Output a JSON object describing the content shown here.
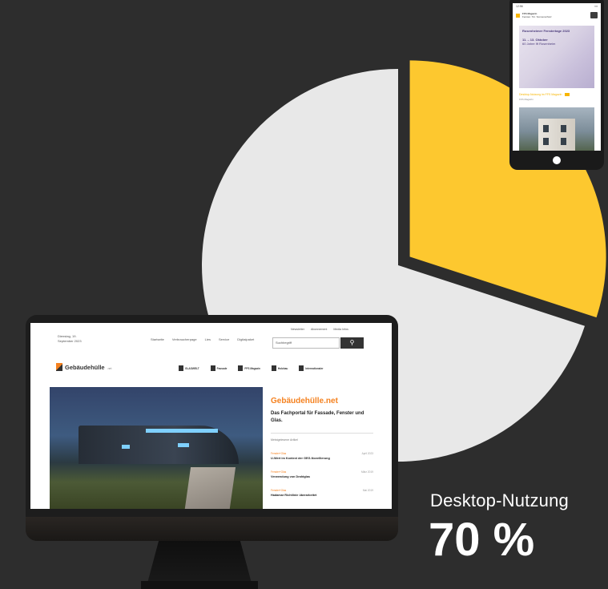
{
  "chart_data": {
    "type": "pie",
    "slices": [
      {
        "label": "Desktop-Nutzung",
        "value": 70,
        "color": "#e8e8e8"
      },
      {
        "label": "",
        "value": 30,
        "color": "#fdc82f"
      }
    ]
  },
  "labels": {
    "desktop_name": "Desktop-Nutzung",
    "desktop_value": "70 %"
  },
  "colors": {
    "background": "#2d2d2d",
    "accent": "#fdc82f",
    "brand": "#f58220"
  },
  "tablet_site": {
    "status_time": "12:56",
    "brand": "FFS Magazin",
    "tagline": "Fenster. Tür. Sonnenschutz",
    "hero_title": "Rosenheimer Fenstertage 2023",
    "hero_dates": "11. – 13. Oktober",
    "hero_sub": "60 Jahre Ift Rosenheim",
    "promo_label": "Desktop-Nutzung im FFS Magazin",
    "promo_sub": "FFS Magazin"
  },
  "desktop_site": {
    "date_line1": "Dienstag, 19.",
    "date_line2": "September 2023",
    "nav": [
      "Startseite",
      "Verbraucherpage",
      "Lies",
      "Service",
      "Digitalpaket"
    ],
    "top_links": [
      "Newsletter",
      "Abonnement",
      "Media Infos"
    ],
    "search_placeholder": "Suchbegriff",
    "brand_name": "Gebäudehülle",
    "brand_tld": ".net",
    "partners": [
      "GLASWELT",
      "Fassade",
      "FFS Magazin",
      "Holzbau",
      "Internationaler"
    ],
    "side_title": "Gebäudehülle.net",
    "side_subtitle": "Das Fachportal für Fassade, Fenster und Glas.",
    "side_label": "Meistgelesene Artikel",
    "articles": [
      {
        "category": "Fenster+Glas",
        "date": "April 2023",
        "title": "U-Wert im Kontext der GEG-Novellierung"
      },
      {
        "category": "Fenster+Glas",
        "date": "März 2019",
        "title": "Verwendung von Drahtglas"
      },
      {
        "category": "Fenster+Glas",
        "date": "Mai 2019",
        "title": "Hadamar Richtlinie überarbeitet"
      }
    ]
  }
}
